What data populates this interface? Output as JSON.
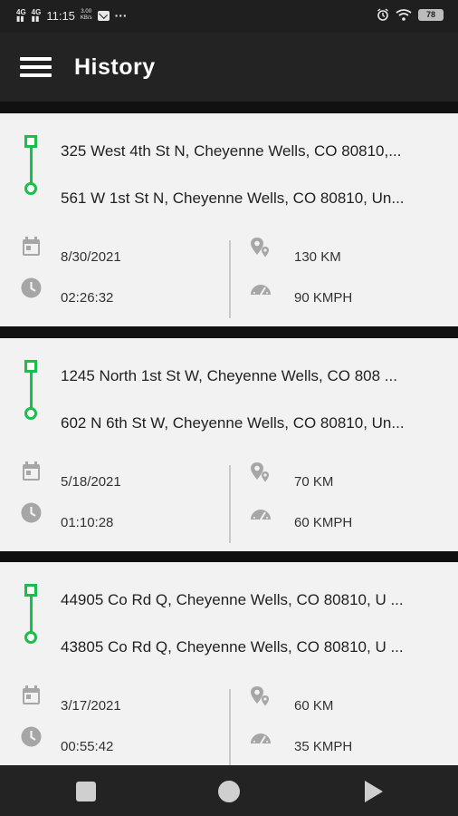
{
  "status_bar": {
    "signal_1": "4G",
    "signal_2": "4G",
    "time": "11:15",
    "speed_value": "3.00",
    "speed_unit": "KB/s",
    "dots": "···",
    "battery": "78"
  },
  "header": {
    "title": "History"
  },
  "trips": [
    {
      "from": "325 West 4th St N, Cheyenne Wells, CO 80810,...",
      "to": "561 W 1st St N, Cheyenne Wells, CO 80810, Un...",
      "date": "8/30/2021",
      "duration": "02:26:32",
      "distance": "130 KM",
      "speed": "90 KMPH"
    },
    {
      "from": "1245 North 1st St W, Cheyenne Wells, CO 808 ...",
      "to": "602 N 6th St W, Cheyenne Wells, CO 80810, Un...",
      "date": "5/18/2021",
      "duration": "01:10:28",
      "distance": "70 KM",
      "speed": "60 KMPH"
    },
    {
      "from": "44905 Co Rd Q, Cheyenne Wells, CO 80810, U ...",
      "to": "43805 Co Rd Q, Cheyenne Wells, CO 80810, U ...",
      "date": "3/17/2021",
      "duration": "00:55:42",
      "distance": "60 KM",
      "speed": "35 KMPH"
    }
  ],
  "icons": {
    "menu": "hamburger-menu-icon",
    "calendar": "calendar-icon",
    "clock": "clock-icon",
    "distance": "route-pins-icon",
    "speed": "speedometer-icon",
    "recents": "nav-recents-icon",
    "home": "nav-home-icon",
    "back": "nav-back-icon"
  },
  "colors": {
    "route_green": "#18c04a",
    "app_bar": "#232323",
    "card_bg": "#f2f2f2"
  }
}
